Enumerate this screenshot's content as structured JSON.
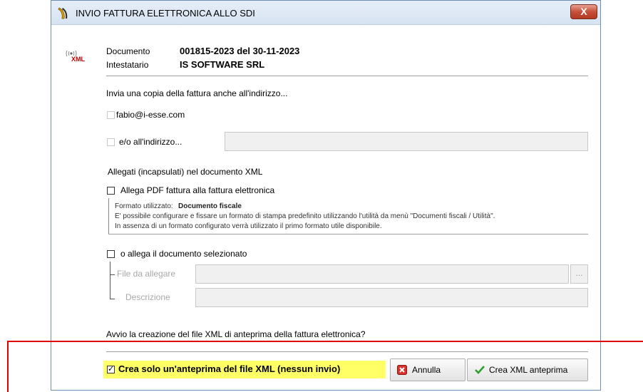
{
  "window": {
    "title": "INVIO FATTURA ELETTRONICA ALLO SDI",
    "close_label": "X"
  },
  "header": {
    "icon_text": "XML",
    "document_label": "Documento",
    "document_value": "001815-2023 del 30-11-2023",
    "holder_label": "Intestatario",
    "holder_value": "IS SOFTWARE SRL"
  },
  "copy_section": {
    "heading": "Invia una copia della fattura anche all'indirizzo...",
    "email_option": "fabio@i-esse.com",
    "email_checked": false,
    "other_option": "e/o all'indirizzo...",
    "other_checked": false,
    "other_value": ""
  },
  "attachments": {
    "heading": "Allegati (incapsulati) nel documento XML",
    "pdf_option": "Allega PDF fattura alla fattura elettronica",
    "pdf_checked": false,
    "format_label": "Formato utilizzato:",
    "format_value": "Documento fiscale",
    "info_line1": "E' possibile configurare e fissare un formato di stampa predefinito utilizzando l'utilità da menù \"Documenti fiscali / Utilità\".",
    "info_line2": "In assenza di un formato configurato verrà utilizzato il primo formato utile disponibile.",
    "doc_option": "o allega il documento selezionato",
    "doc_checked": false,
    "file_label": "File da allegare",
    "file_value": "",
    "browse_label": "...",
    "desc_label": "Descrizione",
    "desc_value": ""
  },
  "footer": {
    "question": "Avvio la creazione del file XML di anteprima della fattura elettronica?",
    "preview_only_option": "Crea solo un'anteprima del file XML (nessun invio)",
    "preview_only_checked": true,
    "cancel_label": "Annulla",
    "create_label": "Crea XML anteprima"
  },
  "colors": {
    "highlight": "#ffff66",
    "annotation_red": "#e00000",
    "close_button": "#c7503a"
  }
}
